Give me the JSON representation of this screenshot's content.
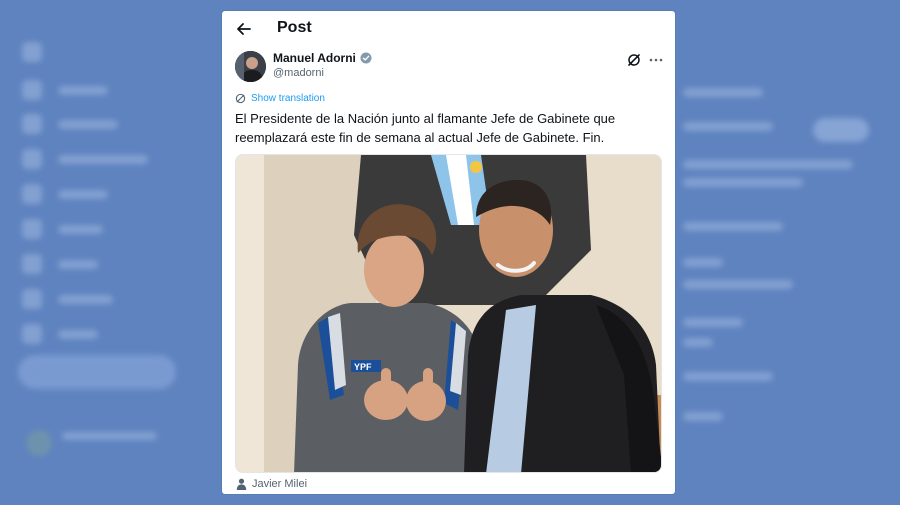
{
  "header": {
    "title": "Post"
  },
  "tweet": {
    "author_name": "Manuel Adorni",
    "author_handle": "@madorni",
    "show_translation": "Show translation",
    "text": "El Presidente de la Nación junto al flamante Jefe de Gabinete que reemplazará este fin de semana al actual Jefe de Gabinete. Fin.",
    "tagged_user": "Javier Milei"
  },
  "icons": {
    "back": "arrow-left-icon",
    "verified": "verified-badge-icon",
    "grok": "grok-icon",
    "more": "more-horizontal-icon",
    "translate": "globe-icon",
    "tag": "person-icon"
  },
  "colors": {
    "background": "#5f83bf",
    "link": "#1d9bf0",
    "text": "#0f1419",
    "muted": "#536471"
  }
}
